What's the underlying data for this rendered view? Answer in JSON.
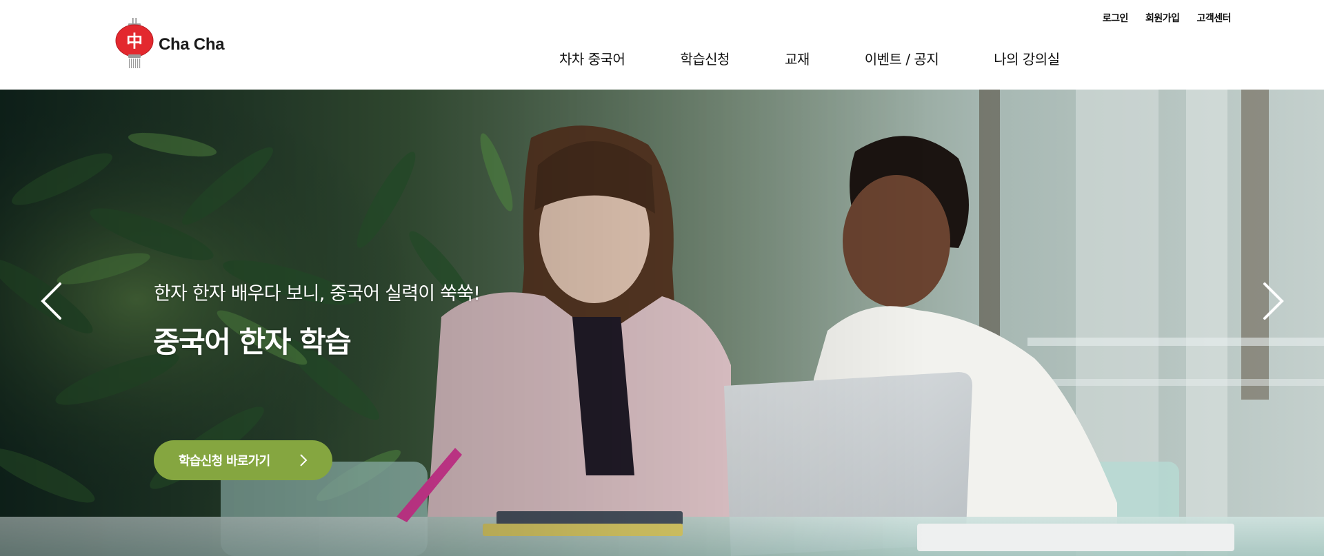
{
  "brand": {
    "name": "Cha Cha",
    "logo_glyph": "中",
    "logo_color": "#e3282e"
  },
  "header": {
    "util_links": [
      "로그인",
      "회원가입",
      "고객센터"
    ],
    "nav": [
      "차차 중국어",
      "학습신청",
      "교재",
      "이벤트 / 공지",
      "나의 강의실"
    ]
  },
  "hero": {
    "subtitle": "한자 한자 배우다 보니, 중국어 실력이 쑥쑥!",
    "title": "중국어 한자 학습",
    "cta_label": "학습신청 바로가기",
    "cta_color": "#85a640",
    "prev_icon": "chevron-left-icon",
    "next_icon": "chevron-right-icon"
  }
}
